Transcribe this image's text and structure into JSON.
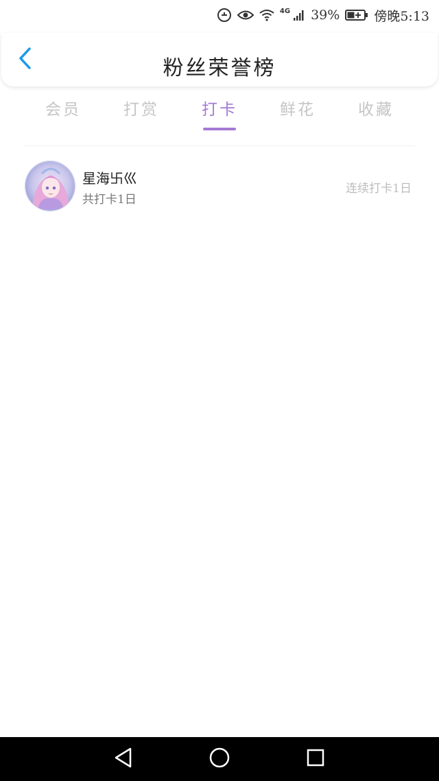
{
  "status_bar": {
    "network": "4G",
    "battery_percent": "39%",
    "time": "傍晚5:13"
  },
  "header": {
    "title": "粉丝荣誉榜"
  },
  "tabs": [
    {
      "label": "会员",
      "active": false
    },
    {
      "label": "打赏",
      "active": false
    },
    {
      "label": "打卡",
      "active": true
    },
    {
      "label": "鲜花",
      "active": false
    },
    {
      "label": "收藏",
      "active": false
    }
  ],
  "list": [
    {
      "name": "星海卐巛",
      "total": "共打卡1日",
      "streak": "连续打卡1日"
    }
  ],
  "colors": {
    "accent": "#a57ad3",
    "back_arrow": "#1e9be9",
    "inactive_tab": "#c5c5c5",
    "nav_bar": "#000000"
  }
}
